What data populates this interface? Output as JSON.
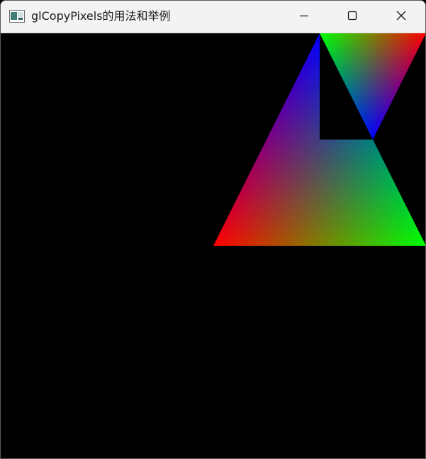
{
  "window": {
    "title": "glCopyPixels的用法和举例"
  },
  "controls": {
    "minimize_icon": "minimize-icon",
    "maximize_icon": "maximize-icon",
    "close_icon": "close-icon"
  },
  "scene": {
    "background": "#000000",
    "vertex_colors": {
      "red": "#ff0000",
      "green": "#00ff00",
      "blue": "#0000ff"
    }
  }
}
